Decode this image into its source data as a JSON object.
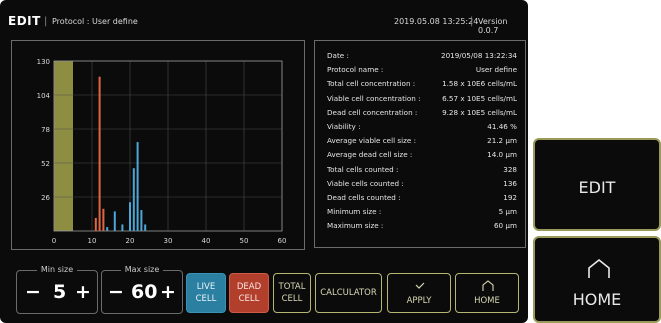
{
  "header": {
    "mode": "EDIT",
    "protocol": "Protocol : User define",
    "datetime": "2019.05.08 13:25:24",
    "version": "Version 0.0.7"
  },
  "chart_data": {
    "type": "bar",
    "x_ticks": [
      "0",
      "10",
      "20",
      "30",
      "40",
      "50",
      "60"
    ],
    "y_ticks": [
      "130",
      "104",
      "78",
      "52",
      "26"
    ],
    "xlim": [
      0,
      60
    ],
    "ylim": [
      0,
      130
    ],
    "grid": true,
    "size_range_band": [
      0,
      5
    ],
    "series": [
      {
        "color": "#e0673f",
        "points": [
          [
            11,
            10
          ],
          [
            12,
            118
          ],
          [
            13,
            17
          ]
        ]
      },
      {
        "color": "#4ca6d6",
        "points": [
          [
            14,
            3
          ],
          [
            16,
            15
          ],
          [
            18,
            5
          ],
          [
            20,
            22
          ],
          [
            21,
            48
          ],
          [
            22,
            68
          ],
          [
            23,
            16
          ],
          [
            24,
            5
          ]
        ]
      }
    ],
    "colors": {
      "band": "#8e8e42",
      "grid": "#4a4a4a",
      "axis": "#9a9a9a"
    }
  },
  "info": [
    {
      "key": "Date :",
      "value": "2019/05/08 13:22:34"
    },
    {
      "key": "Protocol name :",
      "value": "User define"
    },
    {
      "key": "Total cell concentration :",
      "value": "1.58 x 10E6 cells/mL"
    },
    {
      "key": "Viable cell concentration :",
      "value": "6.57 x 10E5 cells/mL"
    },
    {
      "key": "Dead cell concentration :",
      "value": "9.28 x 10E5 cells/mL"
    },
    {
      "key": "Viability :",
      "value": "41.46 %"
    },
    {
      "key": "Average viable cell size :",
      "value": "21.2 μm"
    },
    {
      "key": "Average dead cell size :",
      "value": "14.0 μm"
    },
    {
      "key": "Total cells counted :",
      "value": "328"
    },
    {
      "key": "Viable cells counted :",
      "value": "136"
    },
    {
      "key": "Dead cells counted :",
      "value": "192"
    },
    {
      "key": "Minimum size :",
      "value": "5 μm"
    },
    {
      "key": "Maximum size :",
      "value": "60 μm"
    }
  ],
  "min_size": {
    "label": "Min size",
    "value": "5",
    "minus": "−",
    "plus": "+"
  },
  "max_size": {
    "label": "Max size",
    "value": "60",
    "minus": "−",
    "plus": "+"
  },
  "buttons": {
    "live_1": "LIVE",
    "live_2": "CELL",
    "dead_1": "DEAD",
    "dead_2": "CELL",
    "total_1": "TOTAL",
    "total_2": "CELL",
    "calculator": "CALCULATOR",
    "apply": "APPLY",
    "home": "HOME"
  },
  "side": {
    "edit": "EDIT",
    "home": "HOME"
  }
}
